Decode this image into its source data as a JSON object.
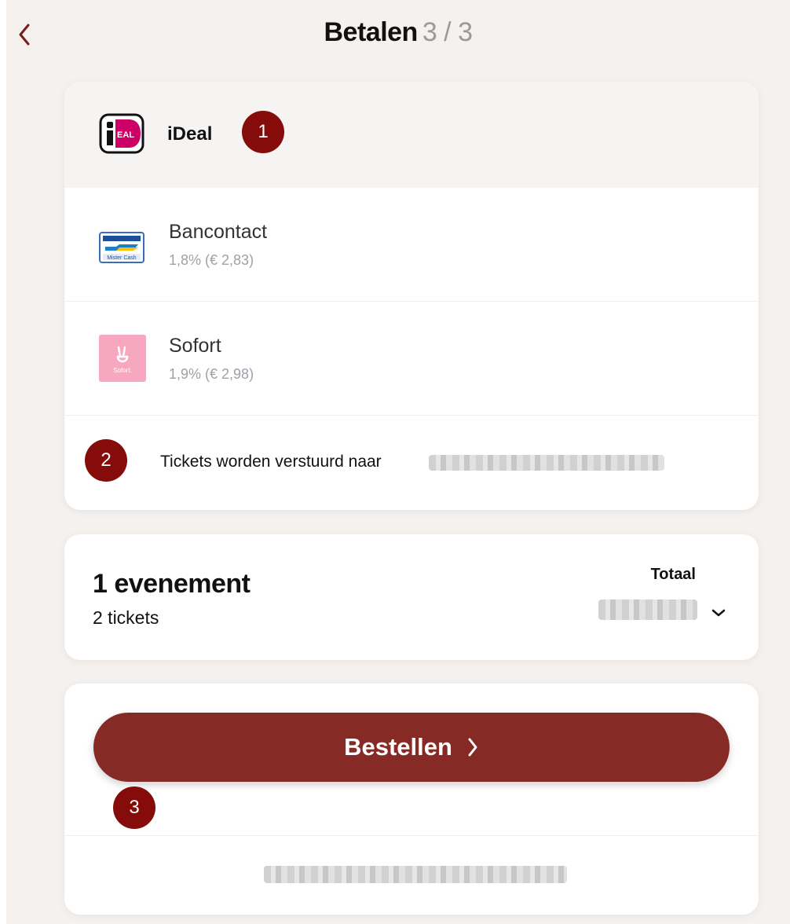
{
  "header": {
    "title": "Betalen",
    "step": "3 / 3"
  },
  "payment_methods": [
    {
      "name": "iDeal",
      "fee": "",
      "icon": "ideal-logo-icon",
      "selected": true
    },
    {
      "name": "Bancontact",
      "fee": "1,8% (€ 2,83)",
      "icon": "bancontact-logo-icon",
      "selected": false
    },
    {
      "name": "Sofort",
      "fee": "1,9% (€ 2,98)",
      "icon": "sofort-logo-icon",
      "selected": false
    }
  ],
  "email_notice": {
    "text": "Tickets worden verstuurd naar"
  },
  "summary": {
    "title": "1 evenement",
    "tickets": "2 tickets",
    "total_label": "Totaal"
  },
  "order": {
    "button_label": "Bestellen"
  },
  "annotations": {
    "badge_1": "1",
    "badge_2": "2",
    "badge_3": "3"
  },
  "colors": {
    "accent": "#852a25",
    "badge": "#860b0b",
    "background": "#f4f1ee",
    "ideal_pink": "#cc0066",
    "sofort_pink": "#f7a8c0"
  }
}
